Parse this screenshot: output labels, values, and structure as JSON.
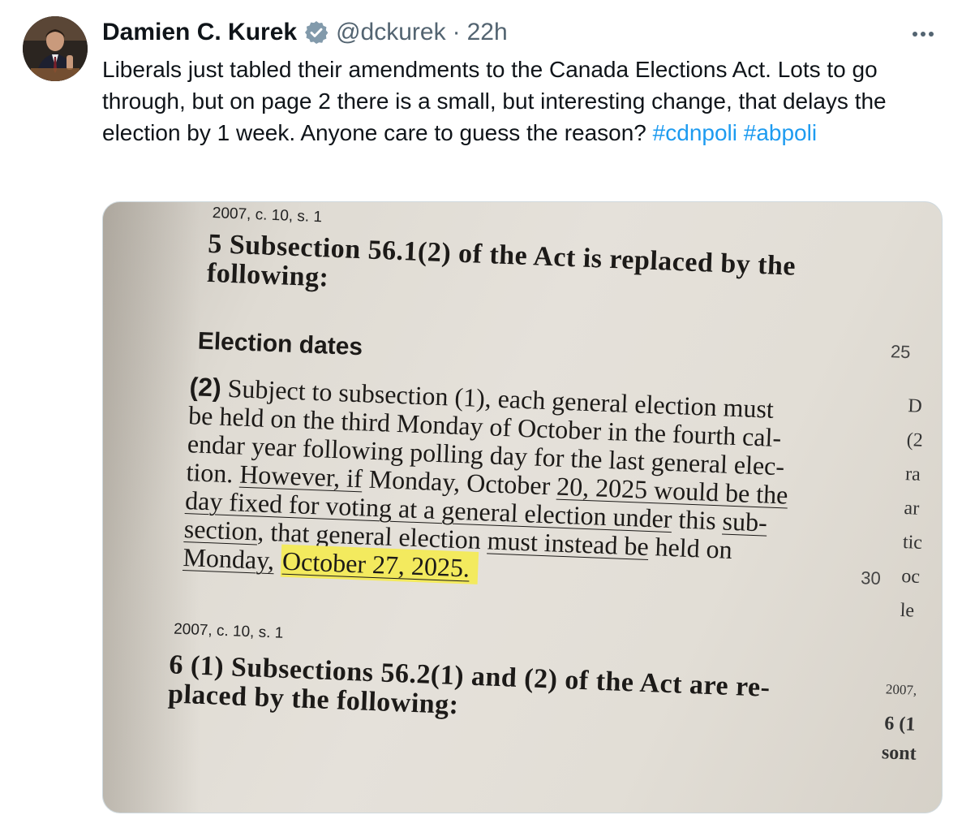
{
  "author": {
    "name": "Damien C. Kurek",
    "handle": "@dckurek",
    "separator": "·",
    "time": "22h"
  },
  "tweet": {
    "text": "Liberals just tabled their amendments to the Canada Elections Act. Lots to go through, but on page 2 there is a small, but interesting change, that delays the election by 1 week. Anyone care to guess the reason?",
    "hashtags": [
      "#cdnpoli",
      "#abpoli"
    ]
  },
  "document": {
    "citation_top": "2007, c. 10, s. 1",
    "section5_heading_line1": "5 Subsection 56.1(2) of the Act is replaced by the",
    "section5_heading_line2": "following:",
    "line_25": "25",
    "subheading": "Election dates",
    "para_lead": "(2)",
    "para_line1": "Subject to subsection (1), each general election must",
    "para_line2": "be held on the third Monday of October in the fourth cal-",
    "para_line3": "endar year following polling day for the last general elec-",
    "para_line4_a": "tion. ",
    "para_line4_b": "However, if",
    "para_line4_c": " Monday, October ",
    "para_line4_d": "20, 2025 would be the",
    "para_line5_a": "day fixed for voting at a general election under",
    "para_line5_b": " this ",
    "para_line5_c": "sub-",
    "para_line6_a": "section",
    "para_line6_b": ", that general election ",
    "para_line6_c": "must instead be",
    "para_line6_d": " held on",
    "para_line7_a": "Monday,",
    "para_line7_b": "October 27, 2025",
    "para_line7_c": ".",
    "line_30": "30",
    "citation_bottom": "2007, c. 10, s. 1",
    "section6_line1": "6 (1) Subsections 56.2(1) and (2) of the Act are re-",
    "section6_line2": "placed by the following:",
    "right_margin": [
      "D",
      "(2",
      "ra",
      "ar",
      "tic",
      "oc",
      "le",
      "2007,",
      "6 (1",
      "sont"
    ]
  }
}
